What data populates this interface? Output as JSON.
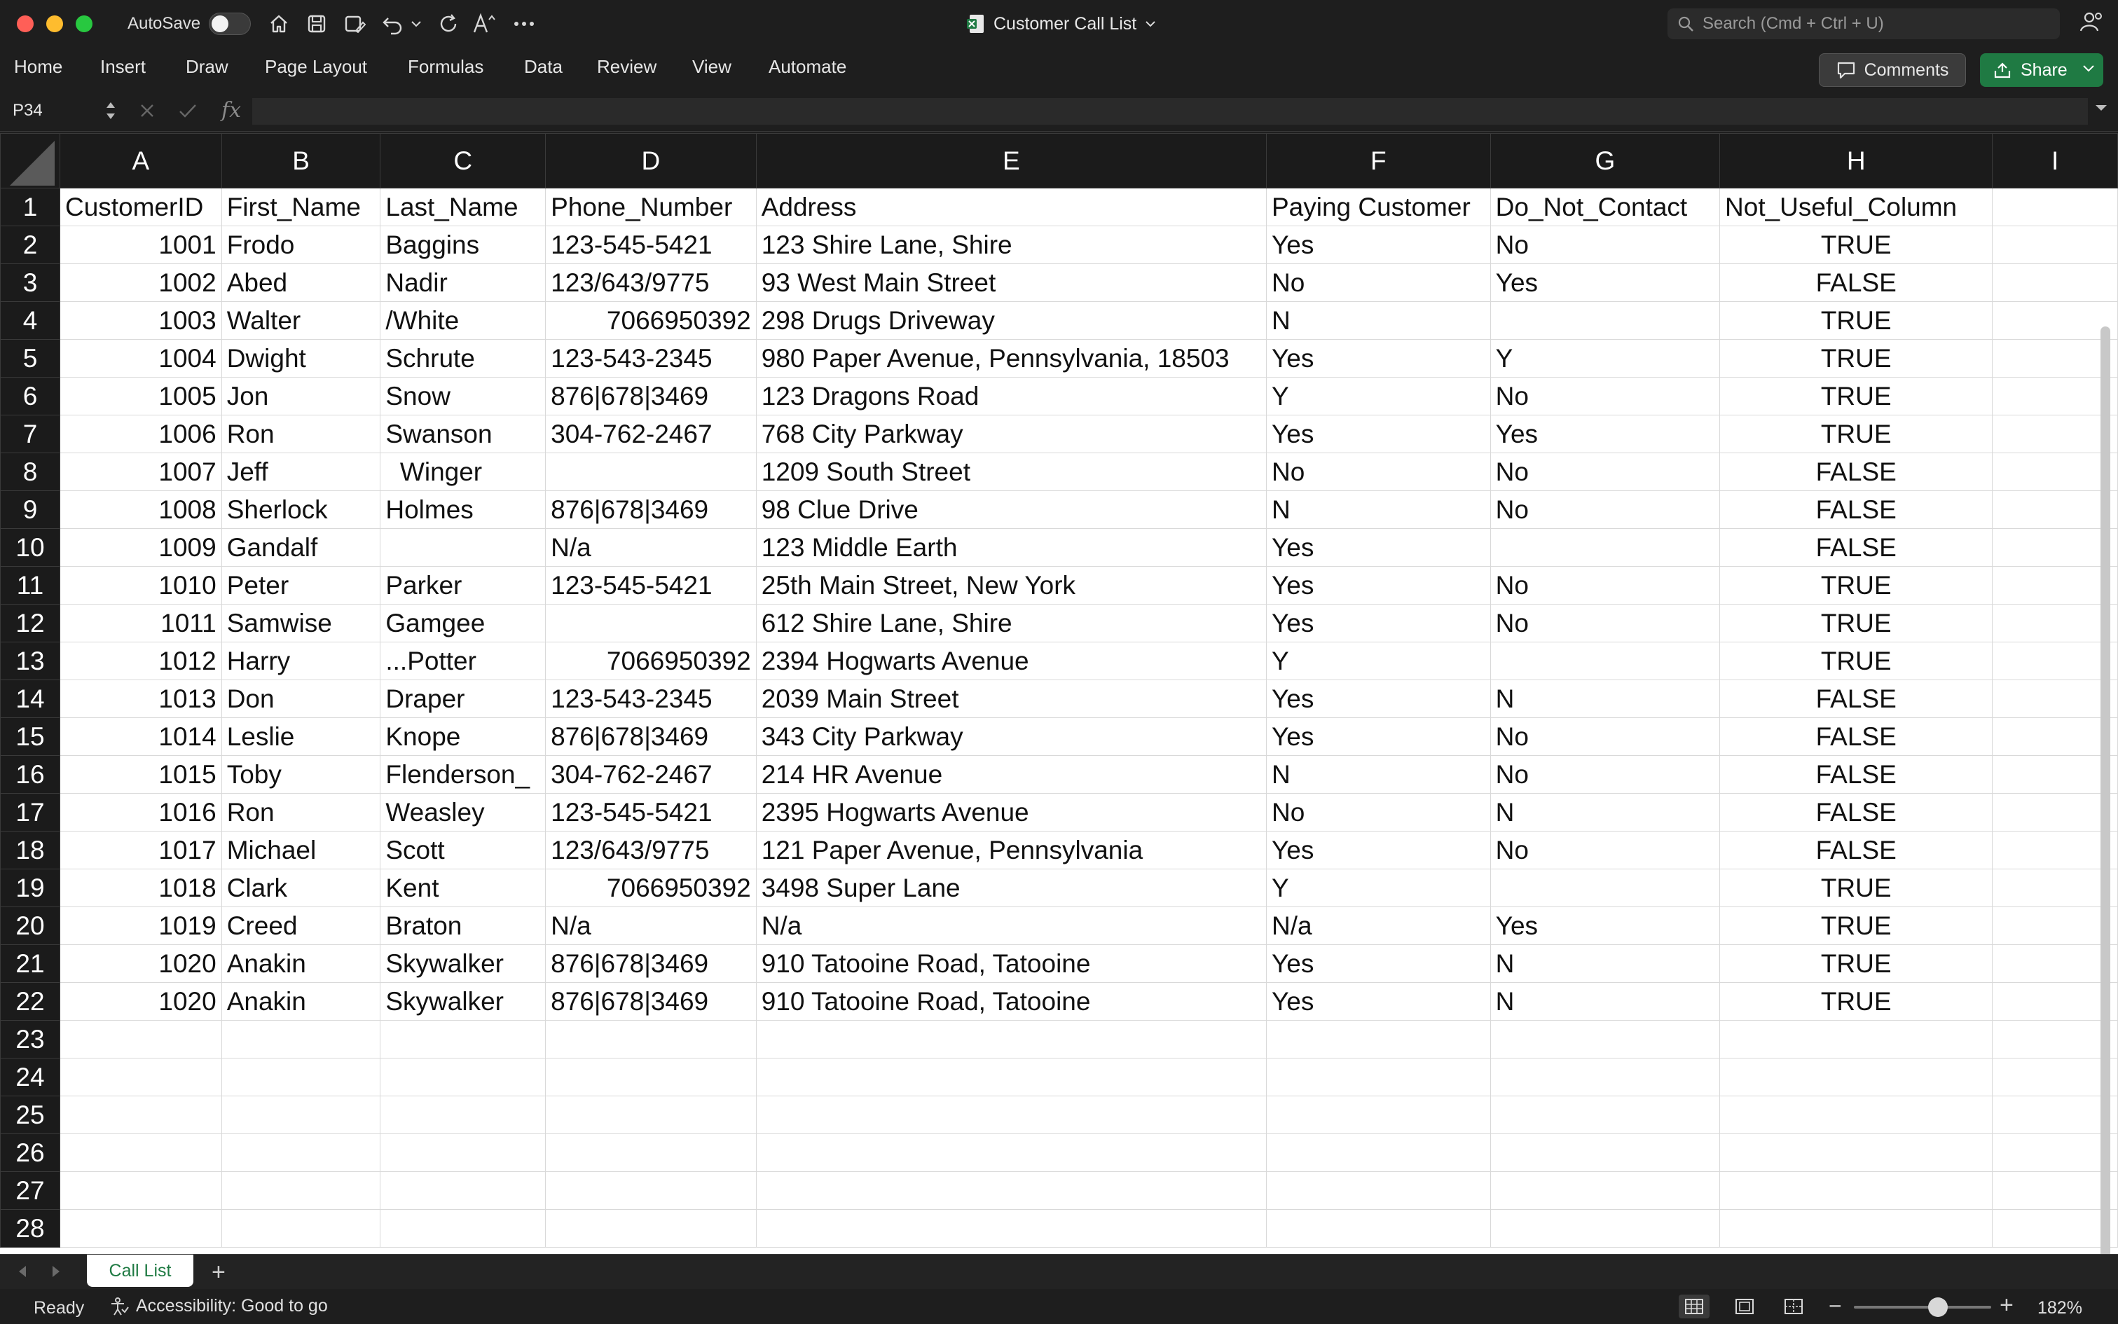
{
  "window": {
    "autosave_label": "AutoSave",
    "title": "Customer Call List",
    "search_placeholder": "Search (Cmd + Ctrl + U)"
  },
  "ribbon": {
    "tabs": [
      "Home",
      "Insert",
      "Draw",
      "Page Layout",
      "Formulas",
      "Data",
      "Review",
      "View",
      "Automate"
    ],
    "comments_label": "Comments",
    "share_label": "Share"
  },
  "formula_bar": {
    "name_box": "P34",
    "fx_label": "fx",
    "formula": ""
  },
  "sheet": {
    "columns": [
      "A",
      "B",
      "C",
      "D",
      "E",
      "F",
      "G",
      "H",
      "I"
    ],
    "row_numbers": [
      "1",
      "2",
      "3",
      "4",
      "5",
      "6",
      "7",
      "8",
      "9",
      "10",
      "11",
      "12",
      "13",
      "14",
      "15",
      "16",
      "17",
      "18",
      "19",
      "20",
      "21",
      "22",
      "23",
      "24",
      "25",
      "26",
      "27",
      "28"
    ],
    "header_row": [
      "CustomerID",
      "First_Name",
      "Last_Name",
      "Phone_Number",
      "Address",
      "Paying Customer",
      "Do_Not_Contact",
      "Not_Useful_Column"
    ],
    "rows": [
      [
        "1001",
        "Frodo",
        "Baggins",
        "123-545-5421",
        "123 Shire Lane, Shire",
        "Yes",
        "No",
        "TRUE"
      ],
      [
        "1002",
        "Abed",
        "Nadir",
        "123/643/9775",
        "93 West Main Street",
        "No",
        "Yes",
        "FALSE"
      ],
      [
        "1003",
        "Walter",
        "/White",
        "7066950392",
        "298 Drugs Driveway",
        "N",
        "",
        "TRUE"
      ],
      [
        "1004",
        "Dwight",
        "Schrute",
        "123-543-2345",
        "980 Paper Avenue, Pennsylvania, 18503",
        "Yes",
        "Y",
        "TRUE"
      ],
      [
        "1005",
        "Jon",
        "Snow",
        "876|678|3469",
        "123 Dragons Road",
        "Y",
        "No",
        "TRUE"
      ],
      [
        "1006",
        "Ron",
        "Swanson",
        "304-762-2467",
        "768 City Parkway",
        "Yes",
        "Yes",
        "TRUE"
      ],
      [
        "1007",
        "Jeff",
        "  Winger",
        "",
        "1209 South Street",
        "No",
        "No",
        "FALSE"
      ],
      [
        "1008",
        "Sherlock",
        "Holmes",
        "876|678|3469",
        "98 Clue Drive",
        "N",
        "No",
        "FALSE"
      ],
      [
        "1009",
        "Gandalf",
        "",
        "N/a",
        "123 Middle Earth",
        "Yes",
        "",
        "FALSE"
      ],
      [
        "1010",
        "Peter",
        "Parker",
        "123-545-5421",
        "25th Main Street, New York",
        "Yes",
        "No",
        "TRUE"
      ],
      [
        "1011",
        "Samwise",
        "Gamgee",
        "",
        "612 Shire Lane, Shire",
        "Yes",
        "No",
        "TRUE"
      ],
      [
        "1012",
        "Harry",
        "...Potter",
        "7066950392",
        "2394 Hogwarts Avenue",
        "Y",
        "",
        "TRUE"
      ],
      [
        "1013",
        "Don",
        "Draper",
        "123-543-2345",
        "2039 Main Street",
        "Yes",
        "N",
        "FALSE"
      ],
      [
        "1014",
        "Leslie",
        "Knope",
        "876|678|3469",
        "343 City Parkway",
        "Yes",
        "No",
        "FALSE"
      ],
      [
        "1015",
        "Toby",
        "Flenderson_",
        "304-762-2467",
        "214 HR Avenue",
        "N",
        "No",
        "FALSE"
      ],
      [
        "1016",
        "Ron",
        "Weasley",
        "123-545-5421",
        "2395 Hogwarts Avenue",
        "No",
        "N",
        "FALSE"
      ],
      [
        "1017",
        "Michael",
        "Scott",
        "123/643/9775",
        "121 Paper Avenue, Pennsylvania",
        "Yes",
        "No",
        "FALSE"
      ],
      [
        "1018",
        "Clark",
        "Kent",
        "7066950392",
        "3498 Super Lane",
        "Y",
        "",
        "TRUE"
      ],
      [
        "1019",
        "Creed",
        "Braton",
        "N/a",
        "N/a",
        "N/a",
        "Yes",
        "TRUE"
      ],
      [
        "1020",
        "Anakin",
        "Skywalker",
        "876|678|3469",
        "910 Tatooine Road, Tatooine",
        "Yes",
        "N",
        "TRUE"
      ],
      [
        "1020",
        "Anakin",
        "Skywalker",
        "876|678|3469",
        "910 Tatooine Road, Tatooine",
        "Yes",
        "N",
        "TRUE"
      ]
    ]
  },
  "sheet_tabs": {
    "active_tab": "Call List",
    "add_label": "+"
  },
  "status_bar": {
    "ready": "Ready",
    "accessibility": "Accessibility: Good to go",
    "zoom_minus": "−",
    "zoom_plus": "+",
    "zoom": "182%"
  },
  "colors": {
    "accent_green": "#1f7a43",
    "close": "#ff5f57",
    "minimize": "#febc2e",
    "maximize": "#28c840"
  }
}
